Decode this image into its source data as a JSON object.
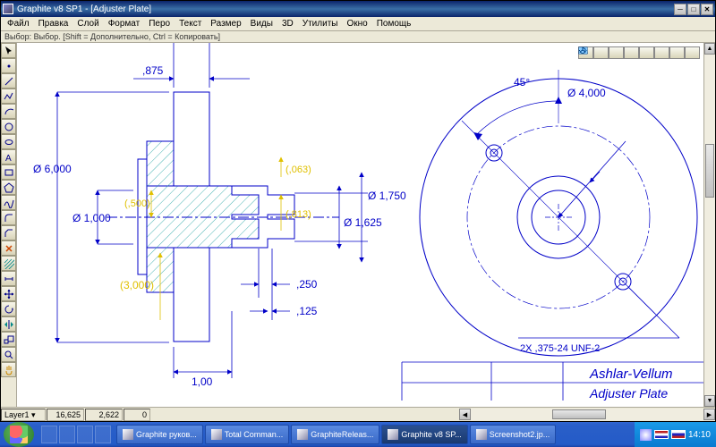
{
  "window": {
    "title": "Graphite v8 SP1 - [Adjuster Plate]"
  },
  "menu": {
    "file": "Файл",
    "edit": "Правка",
    "layer": "Слой",
    "format": "Формат",
    "pen": "Перо",
    "text": "Текст",
    "dimension": "Размер",
    "views": "Виды",
    "threeD": "3D",
    "utilities": "Утилиты",
    "window": "Окно",
    "help": "Помощь"
  },
  "hintbar": "Выбор: Выбор. [Shift = Дополнительно, Ctrl = Копировать]",
  "dims": {
    "d_875": ",875",
    "d_6000": "Ø 6,000",
    "d_1000": "Ø 1,000",
    "d_500": "(,500)",
    "d_3000": "(3,000)",
    "d_063": "(,063)",
    "d_813": "(,813)",
    "d_1750": "Ø 1,750",
    "d_1625": "Ø 1,625",
    "d_250": ",250",
    "d_125": ",125",
    "d_100": "1,00",
    "d_45": "45°",
    "d_4000": "Ø 4,000",
    "d_thread": "2X ,375-24 UNF-2"
  },
  "titleblock": {
    "company": "Ashlar-Vellum",
    "part": "Adjuster Plate"
  },
  "status": {
    "layer": "Layer1",
    "x": "16,625",
    "y": "2,622",
    "z": "0"
  },
  "taskbar": {
    "t1": "Graphite руков...",
    "t2": "Total Comman...",
    "t3": "GraphiteReleas...",
    "t4": "Graphite v8 SP...",
    "t5": "Screenshot2.jp...",
    "clock": "14:10"
  }
}
